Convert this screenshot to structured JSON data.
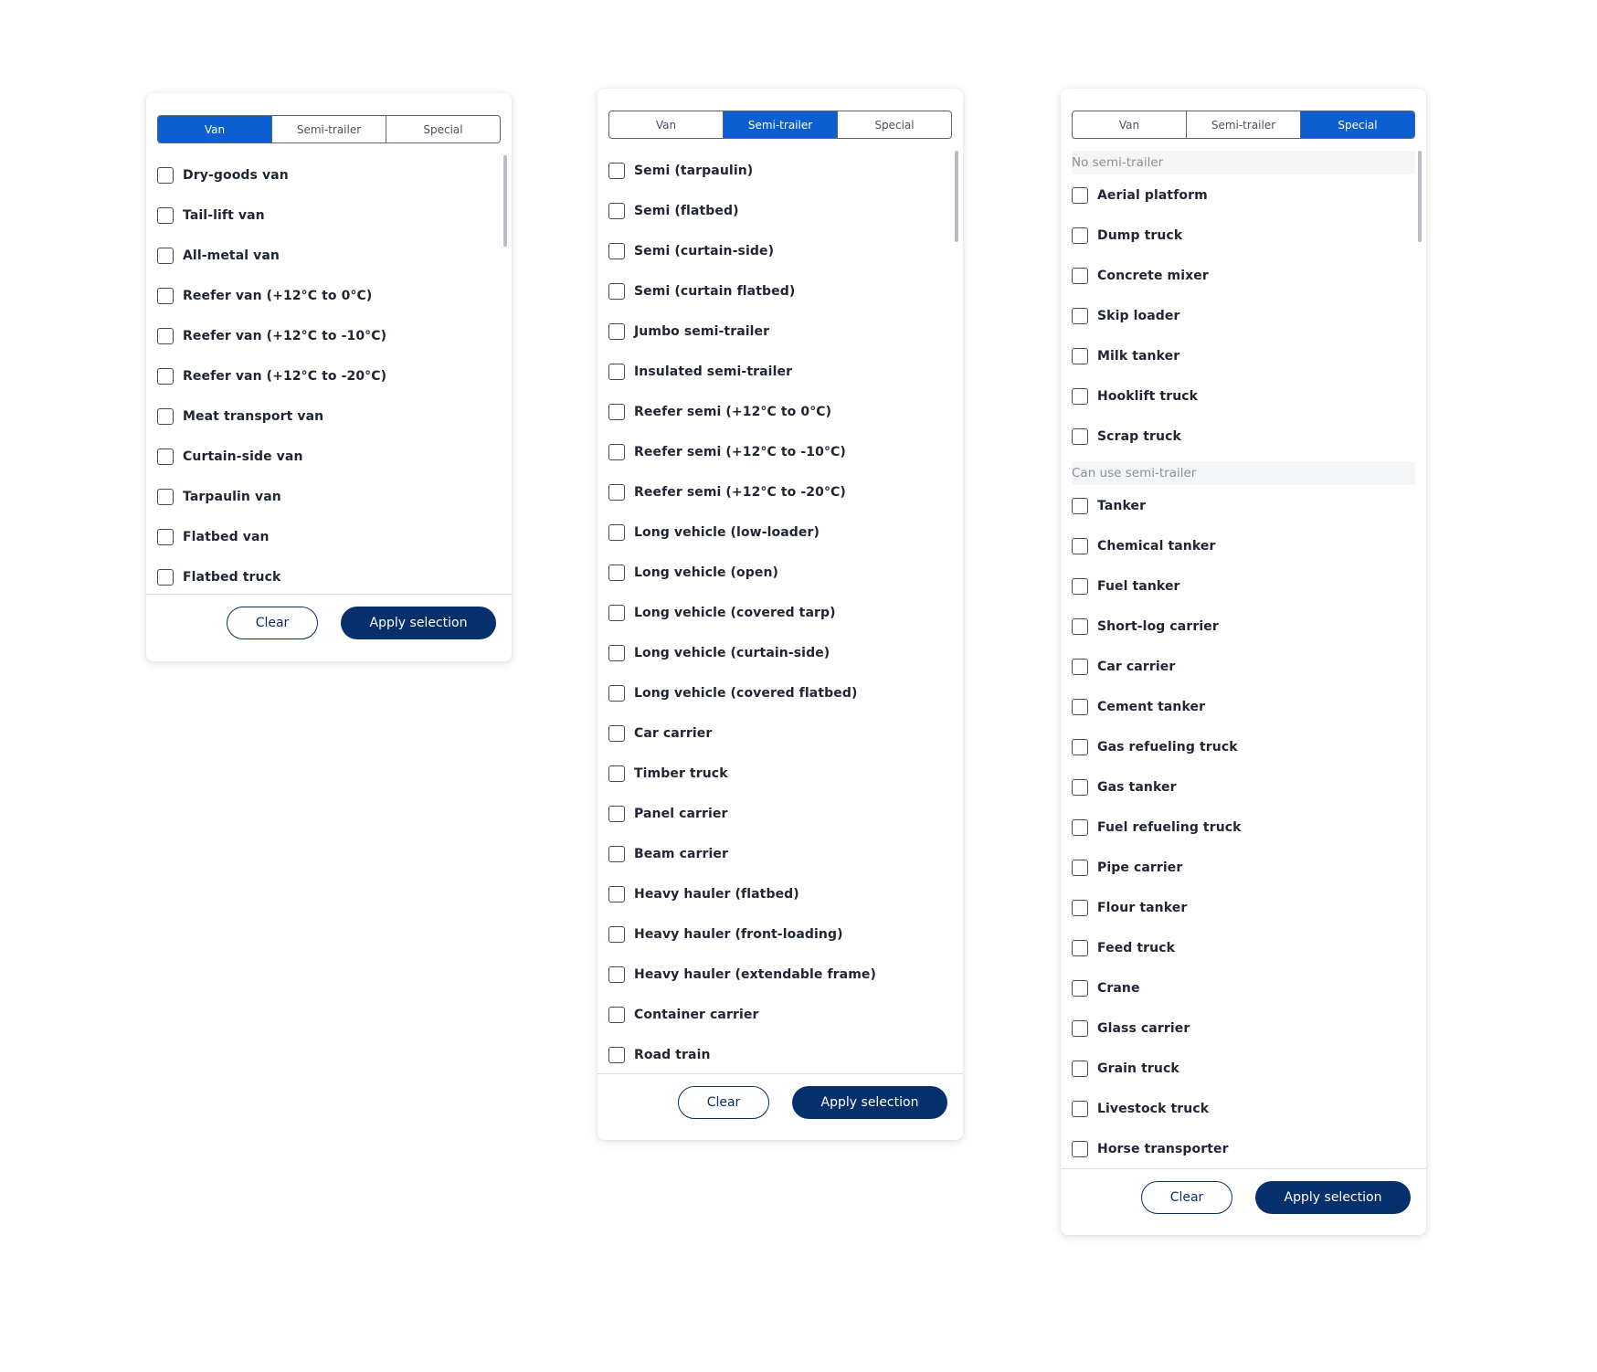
{
  "tabs": [
    "Van",
    "Semi-trailer",
    "Special"
  ],
  "buttons": {
    "clear": "Clear",
    "apply": "Apply selection"
  },
  "colors": {
    "accent": "#0b5fd3",
    "primary_button": "#06306c"
  },
  "panel_van": {
    "active_tab": "Van",
    "items": [
      "Dry-goods van",
      "Tail-lift van",
      "All-metal van",
      "Reefer van (+12°C to 0°C)",
      "Reefer van (+12°C to -10°C)",
      "Reefer van (+12°C to -20°C)",
      "Meat transport van",
      "Curtain-side van",
      "Tarpaulin van",
      "Flatbed van",
      "Flatbed truck"
    ]
  },
  "panel_semi": {
    "active_tab": "Semi-trailer",
    "items": [
      "Semi (tarpaulin)",
      "Semi (flatbed)",
      "Semi (curtain-side)",
      "Semi (curtain flatbed)",
      "Jumbo semi-trailer",
      "Insulated semi-trailer",
      "Reefer semi (+12°C to 0°C)",
      "Reefer semi (+12°C to -10°C)",
      "Reefer semi (+12°C to -20°C)",
      "Long vehicle (low-loader)",
      "Long vehicle (open)",
      "Long vehicle (covered tarp)",
      "Long vehicle (curtain-side)",
      "Long vehicle (covered flatbed)",
      "Car carrier",
      "Timber truck",
      "Panel carrier",
      "Beam carrier",
      "Heavy hauler (flatbed)",
      "Heavy hauler (front-loading)",
      "Heavy hauler (extendable frame)",
      "Container carrier",
      "Road train"
    ]
  },
  "panel_special": {
    "active_tab": "Special",
    "group1_label": "No semi-trailer",
    "group1_items": [
      "Aerial platform",
      "Dump truck",
      "Concrete mixer",
      "Skip loader",
      "Milk tanker",
      "Hooklift truck",
      "Scrap truck"
    ],
    "group2_label": "Can use semi-trailer",
    "group2_items": [
      "Tanker",
      "Chemical tanker",
      "Fuel tanker",
      "Short-log carrier",
      "Car carrier",
      "Cement tanker",
      "Gas refueling truck",
      "Gas tanker",
      "Fuel refueling truck",
      "Pipe carrier",
      "Flour tanker",
      "Feed truck",
      "Crane",
      "Glass carrier",
      "Grain truck",
      "Livestock truck",
      "Horse transporter"
    ]
  }
}
